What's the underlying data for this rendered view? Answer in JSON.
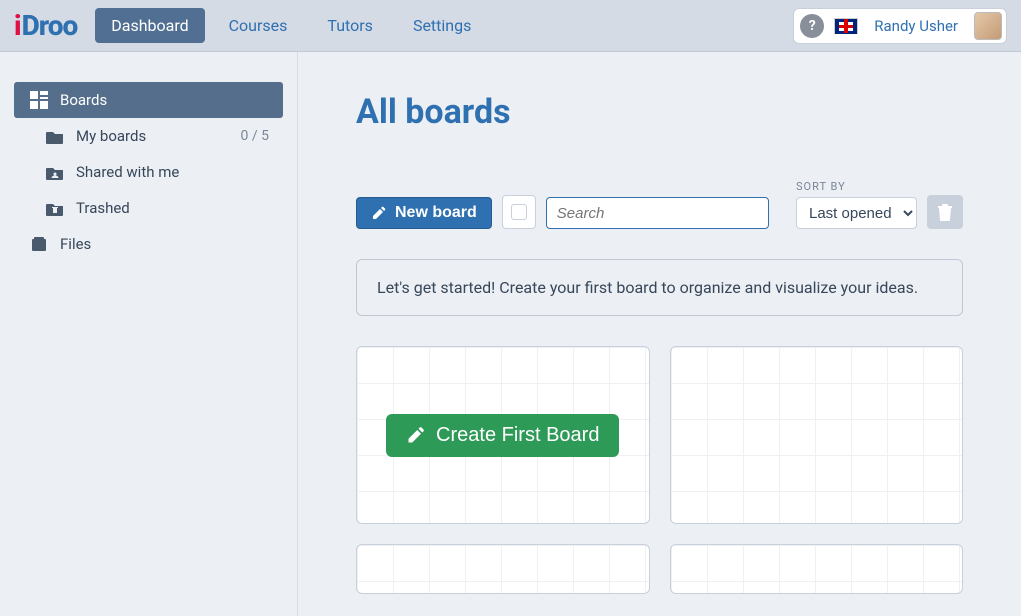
{
  "brand": {
    "i": "i",
    "rest": "Droo"
  },
  "nav": {
    "dashboard": "Dashboard",
    "courses": "Courses",
    "tutors": "Tutors",
    "settings": "Settings"
  },
  "user": {
    "name": "Randy Usher",
    "help_tooltip": "?"
  },
  "sidebar": {
    "boards": "Boards",
    "my_boards": "My boards",
    "my_boards_badge": "0 / 5",
    "shared": "Shared with me",
    "trashed": "Trashed",
    "files": "Files"
  },
  "main": {
    "title": "All boards",
    "new_board": "New board",
    "search_placeholder": "Search",
    "sort_label": "SORT BY",
    "sort_value": "Last opened",
    "banner": "Let's get started! Create your first board to organize and visualize your ideas.",
    "create_first": "Create First Board"
  }
}
